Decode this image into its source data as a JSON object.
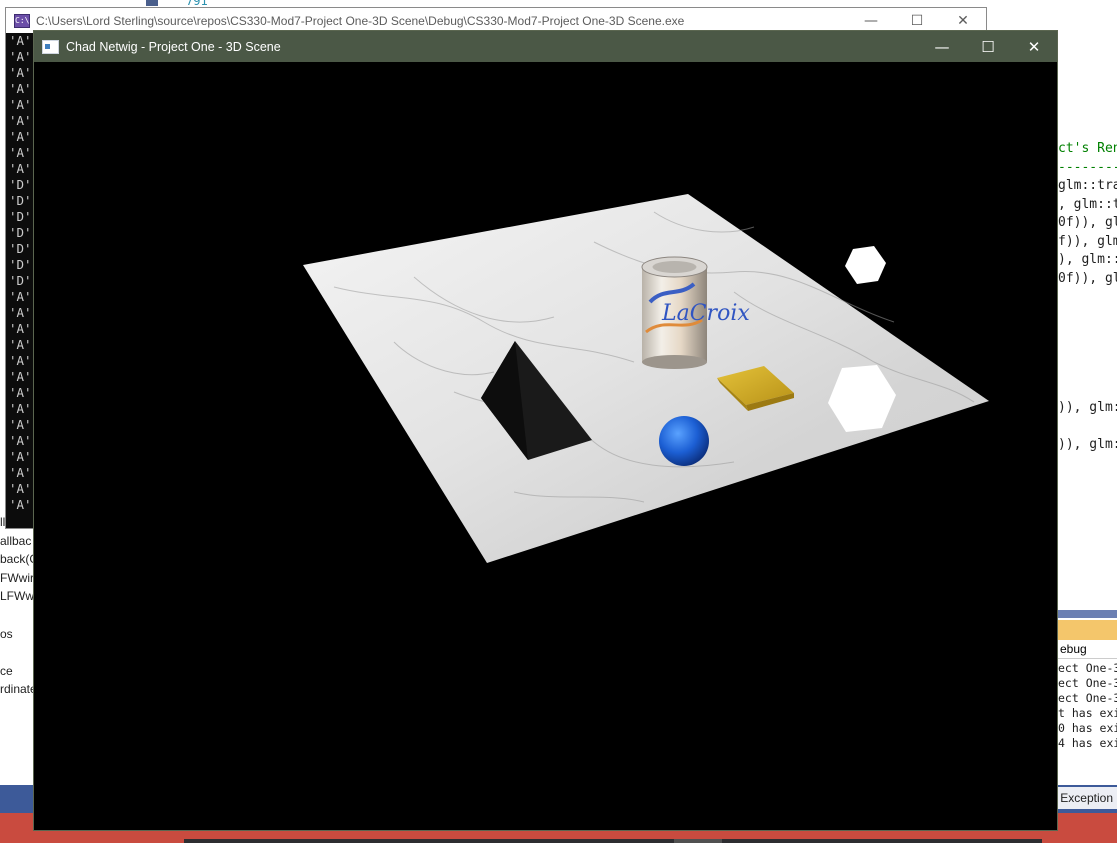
{
  "ide": {
    "line_number": "791",
    "code_right": [
      "ct's Ren",
      "--------",
      "glm::tra",
      ", glm::t",
      "0f)), gl",
      "f)), glm",
      "), glm::",
      "0f)), gl",
      "",
      "",
      "",
      "",
      "",
      "",
      ")), glm:",
      "",
      ")), glm:"
    ],
    "left_panel": [
      "llback(",
      "allbac",
      "back(G",
      "FWwir",
      "LFWw",
      "",
      "os",
      "",
      "ce",
      "rdinate"
    ],
    "output_combo": "ebug",
    "output_lines": [
      "ect One-3",
      "ect One-3",
      "ect One-3",
      "t has exi",
      "0 has exi",
      "4 has exi"
    ],
    "bottom_tabs": [
      "s",
      "Exception"
    ]
  },
  "console": {
    "title": "C:\\Users\\Lord Sterling\\source\\repos\\CS330-Mod7-Project One-3D Scene\\Debug\\CS330-Mod7-Project One-3D Scene.exe",
    "icon_text": "C:\\",
    "lines": [
      "'A'",
      "'A'",
      "'A'",
      "'A'",
      "'A'",
      "'A'",
      "'A'",
      "'A'",
      "'A'",
      "'D'",
      "'D'",
      "'D'",
      "'D'",
      "'D'",
      "'D'",
      "'D'",
      "'A'",
      "'A'",
      "'A'",
      "'A'",
      "'A'",
      "'A'",
      "'A'",
      "'A'",
      "'A'",
      "'A'",
      "'A'",
      "'A'",
      "'A'",
      "'A'"
    ],
    "minimize_icon": "minimize-icon",
    "maximize_icon": "maximize-icon",
    "close_icon": "close-icon"
  },
  "glwindow": {
    "title": "Chad Netwig - Project One - 3D Scene",
    "minimize_glyph": "—",
    "maximize_glyph": "☐",
    "close_glyph": "✕"
  },
  "scene": {
    "background": "#000000",
    "plane_color": "#e9e9e9",
    "sphere_color": "#1f5fd6",
    "book_color": "#d8b42a",
    "can_label": "LaCroix",
    "hexagon_color": "#ffffff"
  }
}
